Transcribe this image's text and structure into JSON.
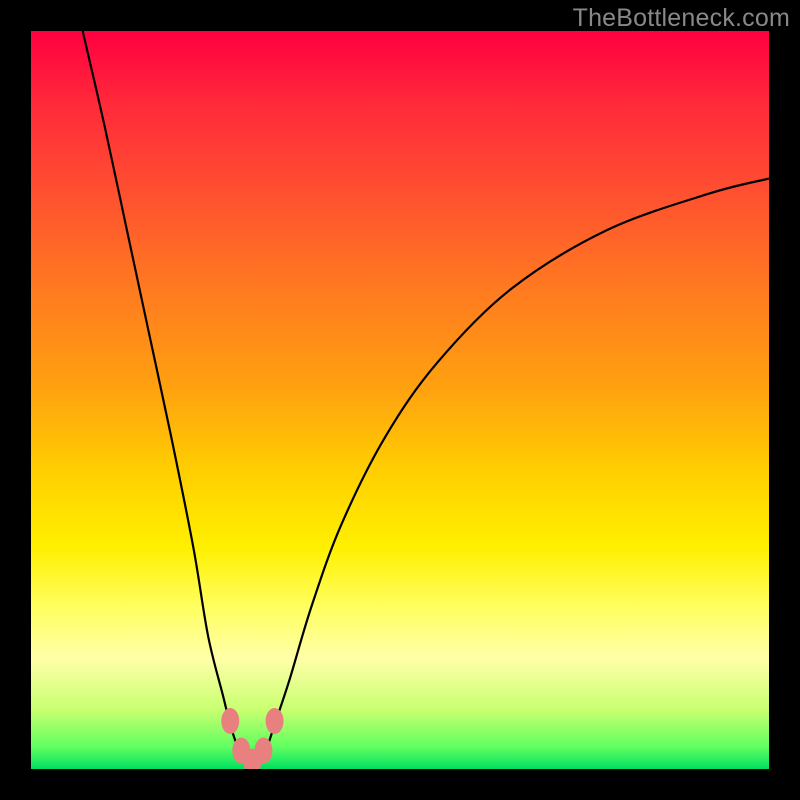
{
  "watermark": "TheBottleneck.com",
  "chart_data": {
    "type": "line",
    "title": "",
    "xlabel": "",
    "ylabel": "",
    "xlim": [
      0,
      100
    ],
    "ylim": [
      0,
      100
    ],
    "series": [
      {
        "name": "bottleneck-curve",
        "x": [
          7,
          10,
          13,
          16,
          19,
          22,
          24,
          26,
          27,
          28,
          29,
          30,
          31,
          32,
          33,
          35,
          38,
          42,
          48,
          55,
          65,
          78,
          92,
          100
        ],
        "y": [
          100,
          87,
          73,
          59,
          45,
          30,
          18,
          10,
          6,
          3,
          1,
          0.5,
          1,
          3,
          6,
          12,
          22,
          33,
          45,
          55,
          65,
          73,
          78,
          80
        ]
      }
    ],
    "markers": [
      {
        "x": 27.0,
        "y": 6.5
      },
      {
        "x": 28.5,
        "y": 2.5
      },
      {
        "x": 30.0,
        "y": 1.0
      },
      {
        "x": 31.5,
        "y": 2.5
      },
      {
        "x": 33.0,
        "y": 6.5
      }
    ],
    "marker_color": "#e88080",
    "gradient_note": "red (top, high bottleneck) to green (bottom, low bottleneck)"
  }
}
